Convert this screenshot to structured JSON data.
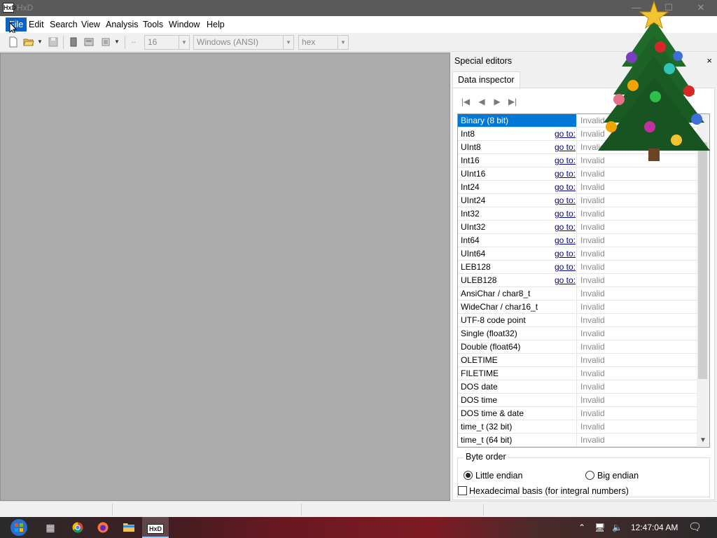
{
  "window": {
    "title": "HxD",
    "app_icon": "HxD"
  },
  "menu": [
    "File",
    "Edit",
    "Search",
    "View",
    "Analysis",
    "Tools",
    "Window",
    "Help"
  ],
  "toolbar": {
    "bytes_per_row": "16",
    "charset": "Windows (ANSI)",
    "offset_base": "hex"
  },
  "panel": {
    "title": "Special editors",
    "close": "×",
    "tab": "Data inspector",
    "rows": [
      {
        "name": "Binary (8 bit)",
        "goto": "",
        "value": "Invalid"
      },
      {
        "name": "Int8",
        "goto": "go to:",
        "value": "Invalid"
      },
      {
        "name": "UInt8",
        "goto": "go to:",
        "value": "Invalid"
      },
      {
        "name": "Int16",
        "goto": "go to:",
        "value": "Invalid"
      },
      {
        "name": "UInt16",
        "goto": "go to:",
        "value": "Invalid"
      },
      {
        "name": "Int24",
        "goto": "go to:",
        "value": "Invalid"
      },
      {
        "name": "UInt24",
        "goto": "go to:",
        "value": "Invalid"
      },
      {
        "name": "Int32",
        "goto": "go to:",
        "value": "Invalid"
      },
      {
        "name": "UInt32",
        "goto": "go to:",
        "value": "Invalid"
      },
      {
        "name": "Int64",
        "goto": "go to:",
        "value": "Invalid"
      },
      {
        "name": "UInt64",
        "goto": "go to:",
        "value": "Invalid"
      },
      {
        "name": "LEB128",
        "goto": "go to:",
        "value": "Invalid"
      },
      {
        "name": "ULEB128",
        "goto": "go to:",
        "value": "Invalid"
      },
      {
        "name": "AnsiChar / char8_t",
        "goto": "",
        "value": "Invalid"
      },
      {
        "name": "WideChar / char16_t",
        "goto": "",
        "value": "Invalid"
      },
      {
        "name": "UTF-8 code point",
        "goto": "",
        "value": "Invalid"
      },
      {
        "name": "Single (float32)",
        "goto": "",
        "value": "Invalid"
      },
      {
        "name": "Double (float64)",
        "goto": "",
        "value": "Invalid"
      },
      {
        "name": "OLETIME",
        "goto": "",
        "value": "Invalid"
      },
      {
        "name": "FILETIME",
        "goto": "",
        "value": "Invalid"
      },
      {
        "name": "DOS date",
        "goto": "",
        "value": "Invalid"
      },
      {
        "name": "DOS time",
        "goto": "",
        "value": "Invalid"
      },
      {
        "name": "DOS time & date",
        "goto": "",
        "value": "Invalid"
      },
      {
        "name": "time_t (32 bit)",
        "goto": "",
        "value": "Invalid"
      },
      {
        "name": "time_t (64 bit)",
        "goto": "",
        "value": "Invalid"
      }
    ],
    "byte_order": {
      "label": "Byte order",
      "little": "Little endian",
      "big": "Big endian"
    },
    "hex_basis": "Hexadecimal basis (for integral numbers)"
  },
  "taskbar": {
    "clock": "12:47:04 AM"
  },
  "colors": {
    "selection": "#0078d7",
    "menu_active": "#0a64c8",
    "link": "#00009c"
  }
}
